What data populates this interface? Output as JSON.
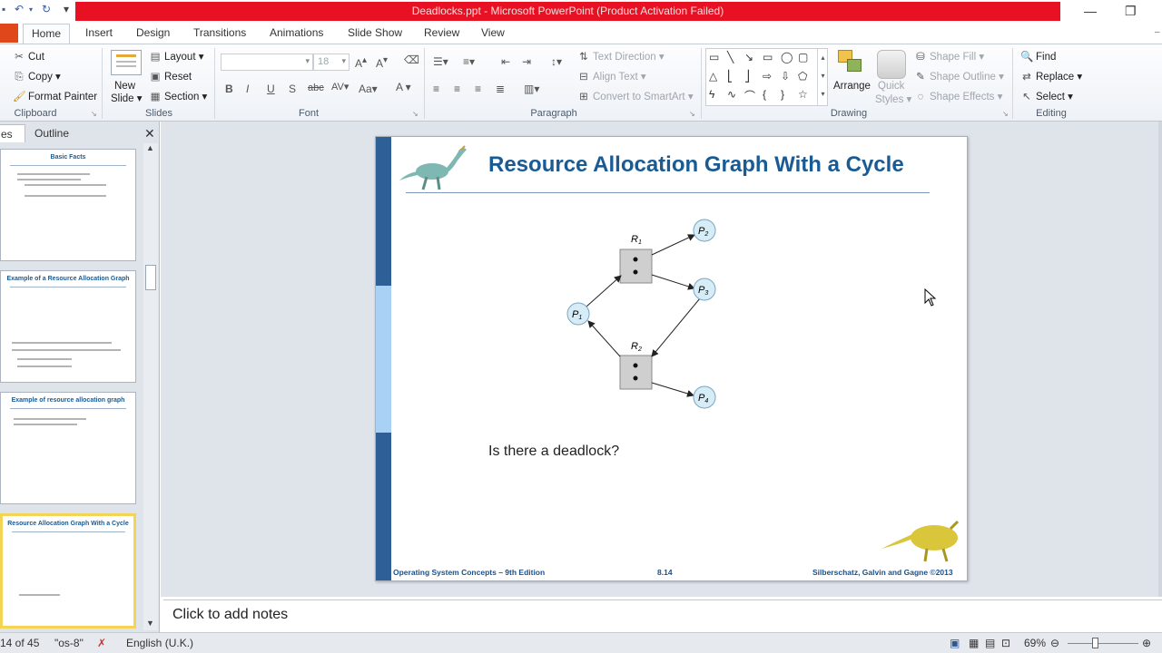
{
  "window": {
    "title": "Deadlocks.ppt  -  Microsoft PowerPoint (Product Activation Failed)"
  },
  "tabs": [
    "Home",
    "Insert",
    "Design",
    "Transitions",
    "Animations",
    "Slide Show",
    "Review",
    "View"
  ],
  "active_tab": "Home",
  "ribbon": {
    "clipboard": {
      "label": "Clipboard",
      "cut": "Cut",
      "copy": "Copy",
      "format_painter": "Format Painter"
    },
    "slides": {
      "label": "Slides",
      "new_slide": "New",
      "new_slide2": "Slide",
      "layout": "Layout",
      "reset": "Reset",
      "section": "Section"
    },
    "font": {
      "label": "Font",
      "size": "18"
    },
    "paragraph": {
      "label": "Paragraph",
      "text_direction": "Text Direction",
      "align_text": "Align Text",
      "convert_smartart": "Convert to SmartArt"
    },
    "drawing": {
      "label": "Drawing",
      "arrange": "Arrange",
      "quick_styles": "Quick",
      "quick_styles2": "Styles",
      "shape_fill": "Shape Fill",
      "shape_outline": "Shape Outline",
      "shape_effects": "Shape Effects"
    },
    "editing": {
      "label": "Editing",
      "find": "Find",
      "replace": "Replace",
      "select": "Select"
    }
  },
  "left_pane": {
    "tab_slides": "es",
    "tab_outline": "Outline",
    "thumbs": [
      {
        "title": "Basic Facts"
      },
      {
        "title": "Example of a Resource Allocation Graph"
      },
      {
        "title": "Example of resource allocation graph"
      },
      {
        "title": "Resource Allocation Graph With a Cycle"
      }
    ]
  },
  "slide": {
    "title": "Resource Allocation Graph With a Cycle",
    "question": "Is there a deadlock?",
    "footer_left": "Operating System Concepts – 9th Edition",
    "footer_mid": "8.14",
    "footer_right": "Silberschatz, Galvin and Gagne ©2013",
    "graph": {
      "r1": "R",
      "r1_sub": "1",
      "r2": "R",
      "r2_sub": "2",
      "p1": "P",
      "p1_sub": "1",
      "p2": "P",
      "p2_sub": "2",
      "p3": "P",
      "p3_sub": "3",
      "p4": "P",
      "p4_sub": "4"
    }
  },
  "notes": {
    "placeholder": "Click to add notes"
  },
  "status": {
    "slide_info": "14 of 45",
    "theme": "\"os-8\"",
    "language": "English (U.K.)",
    "zoom": "69%"
  }
}
